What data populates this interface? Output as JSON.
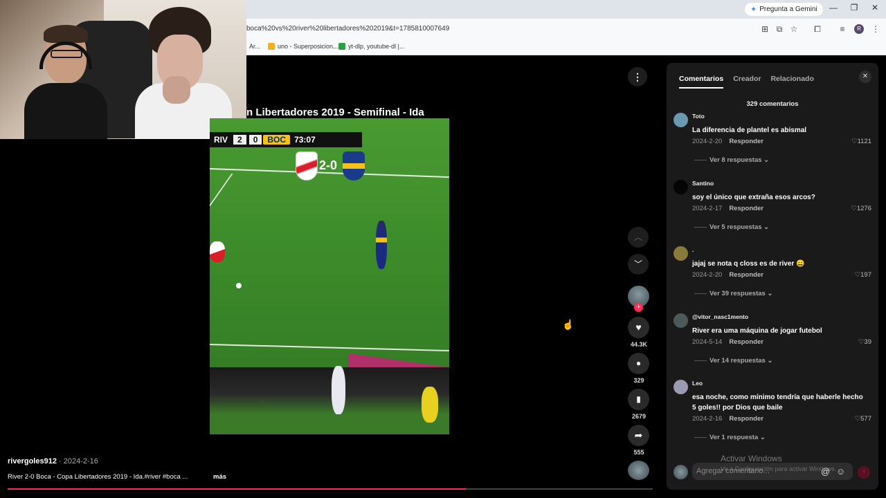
{
  "browser": {
    "gemini_label": "Pregunta a Gemini",
    "url": "boca%20vs%20river%20libertadores%202019&t=1785810007649",
    "avatar_letter": "R",
    "bookmarks": [
      "Ar...",
      "uno - Superposicion...",
      "yt-dlp, youtube-dl |..."
    ]
  },
  "video": {
    "title": "n Libertadores 2019 - Semifinal - Ida",
    "scorebug": {
      "home": "RIV",
      "home_score": "2",
      "away_score": "0",
      "away": "BOC",
      "clock": "73:07"
    },
    "big_score": "2-0"
  },
  "actions": {
    "likes": "44.3K",
    "comments": "329",
    "saves": "2679",
    "shares": "555"
  },
  "post": {
    "author": "rivergoles912",
    "date": " · 2024-2-16",
    "caption": "River 2-0 Boca - Copa Libertadores 2019 - Ida.#river #boca ...",
    "more": "más",
    "progress": 0.71
  },
  "panel": {
    "tabs": [
      "Comentarios",
      "Creador",
      "Relacionado"
    ],
    "count_label": "329 comentarios",
    "reply_label": "Responder",
    "comments": [
      {
        "user": "Toto",
        "text": "La diferencia de plantel es abismal",
        "date": "2024-2-20",
        "likes": "1121",
        "replies": "Ver 8 respuestas",
        "avatar_color": "#6a9ab0"
      },
      {
        "user": "Santino",
        "text": "soy el único que extraña esos arcos?",
        "date": "2024-2-17",
        "likes": "1276",
        "replies": "Ver 5 respuestas",
        "avatar_color": "#050505"
      },
      {
        "user": ".",
        "text": "jajaj se nota q closs es de river 😄",
        "date": "2024-2-20",
        "likes": "197",
        "replies": "Ver 39 respuestas",
        "avatar_color": "#8a7a3a"
      },
      {
        "user": "@vitor_nasc1mento",
        "text": "River era uma máquina de jogar futebol",
        "date": "2024-5-14",
        "likes": "39",
        "replies": "Ver 14 respuestas",
        "avatar_color": "#4a5a5a"
      },
      {
        "user": "Leo",
        "text": "esa noche, como mínimo tendría que haberle hecho 5 goles!! por Dios que baile",
        "date": "2024-2-16",
        "likes": "577",
        "replies": "Ver 1 respuesta",
        "avatar_color": "#9a9ab0"
      }
    ],
    "input_placeholder": "Agregar comentario..."
  },
  "watermark": {
    "line1": "Activar Windows",
    "line2": "Ve a Configuración para activar Windows."
  }
}
